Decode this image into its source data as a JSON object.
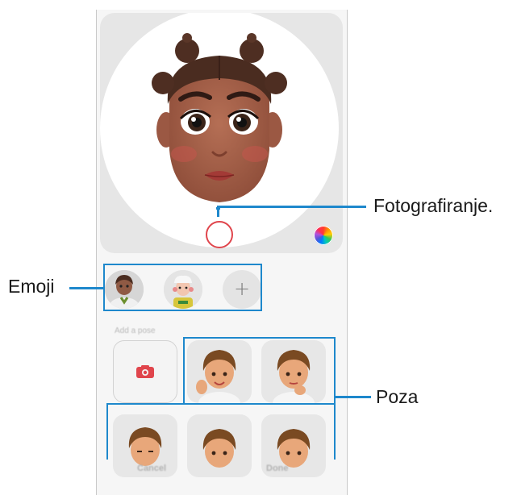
{
  "screen": {
    "section_title": "Add a pose",
    "buttons": {
      "cancel": "Cancel",
      "done": "Done"
    },
    "add_emoji_symbol": "+"
  },
  "callouts": {
    "capture": "Fotografiranje.",
    "emoji": "Emoji",
    "pose": "Poza"
  },
  "icons": {
    "shutter": "shutter-button-icon",
    "color": "color-palette-icon",
    "camera": "camera-icon",
    "add": "plus-icon"
  },
  "colors": {
    "callout": "#1e88cc",
    "shutter_ring": "#e0454c",
    "camera_icon": "#e0454c"
  }
}
